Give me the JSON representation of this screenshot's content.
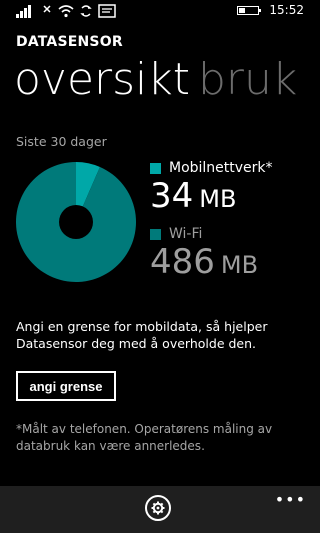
{
  "status_bar": {
    "time": "15:52",
    "icons": [
      "signal-icon",
      "no-sim-icon",
      "wifi-icon",
      "data-sync-icon",
      "message-icon"
    ],
    "battery_level": 0.3
  },
  "app": {
    "title": "DATASENSOR"
  },
  "pivot": {
    "active": "oversikt",
    "inactive": "bruk"
  },
  "usage": {
    "period_label": "Siste 30 dager",
    "mobile": {
      "label": "Mobilnettverk*",
      "value": "34",
      "unit": "MB",
      "color": "#00a8a8"
    },
    "wifi": {
      "label": "Wi-Fi",
      "value": "486",
      "unit": "MB",
      "color": "#007a7a"
    }
  },
  "chart_data": {
    "type": "pie",
    "categories": [
      "Mobilnettverk*",
      "Wi-Fi"
    ],
    "values": [
      34,
      486
    ],
    "colors": [
      "#00a8a8",
      "#007a7a"
    ],
    "title": ""
  },
  "info": {
    "text": "Angi en grense for mobildata, så hjelper Datasensor deg med å overholde den.",
    "button_label": "angi grense",
    "footnote": "*Målt av telefonen. Operatørens måling av databruk kan være annerledes."
  },
  "appbar": {
    "settings_icon": "gear-icon",
    "more_label": "•••"
  },
  "colors": {
    "background": "#000000",
    "accent": "#00a8a8"
  }
}
